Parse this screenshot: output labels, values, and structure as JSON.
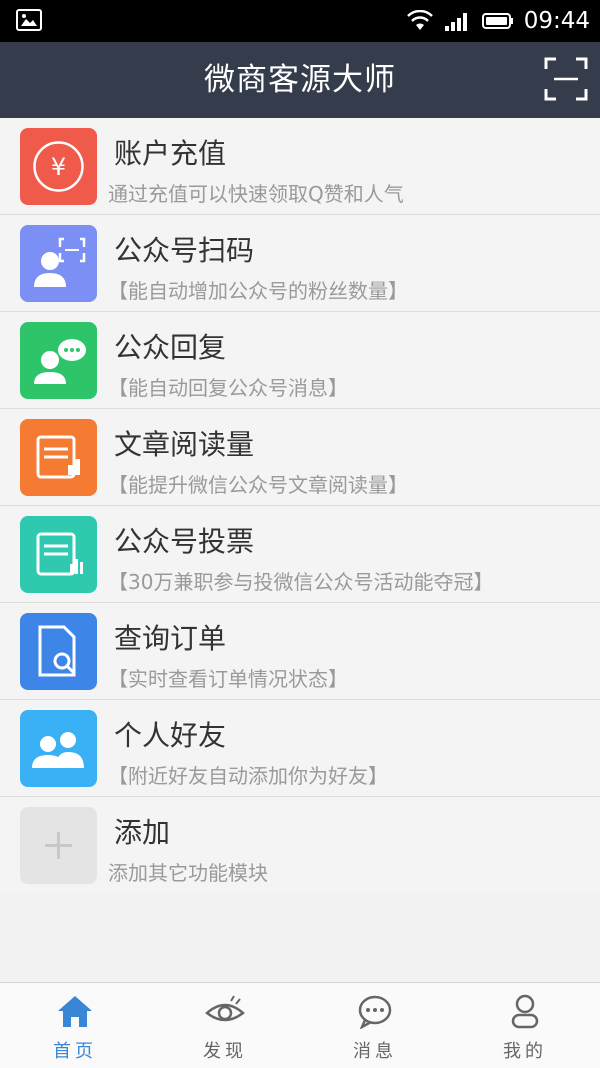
{
  "status_bar": {
    "time": "09:44"
  },
  "header": {
    "title": "微商客源大师"
  },
  "menu": [
    {
      "title": "账户充值",
      "subtitle": "通过充值可以快速领取Q赞和人气",
      "color": "#f05a4a",
      "icon": "yen-coin-icon"
    },
    {
      "title": "公众号扫码",
      "subtitle": "【能自动增加公众号的粉丝数量】",
      "color": "#7b8ff5",
      "icon": "person-scan-icon"
    },
    {
      "title": "公众回复",
      "subtitle": "【能自动回复公众号消息】",
      "color": "#2ec46a",
      "icon": "person-chat-icon"
    },
    {
      "title": "文章阅读量",
      "subtitle": "【能提升微信公众号文章阅读量】",
      "color": "#f57a32",
      "icon": "article-like-icon"
    },
    {
      "title": "公众号投票",
      "subtitle": "【30万兼职参与投微信公众号活动能夺冠】",
      "color": "#2fc9b0",
      "icon": "vote-chart-icon"
    },
    {
      "title": "查询订单",
      "subtitle": "【实时查看订单情况状态】",
      "color": "#3d86e8",
      "icon": "document-search-icon"
    },
    {
      "title": "个人好友",
      "subtitle": "【附近好友自动添加你为好友】",
      "color": "#3ab0f5",
      "icon": "friends-icon"
    },
    {
      "title": "添加",
      "subtitle": "添加其它功能模块",
      "color": "#e4e4e4",
      "icon": "plus-icon"
    }
  ],
  "tabs": [
    {
      "label": "首页",
      "icon": "home-icon",
      "active": true
    },
    {
      "label": "发现",
      "icon": "eye-icon",
      "active": false
    },
    {
      "label": "消息",
      "icon": "message-icon",
      "active": false
    },
    {
      "label": "我的",
      "icon": "user-icon",
      "active": false
    }
  ],
  "colors": {
    "header": "#353c4b",
    "accent": "#3a86d6"
  }
}
